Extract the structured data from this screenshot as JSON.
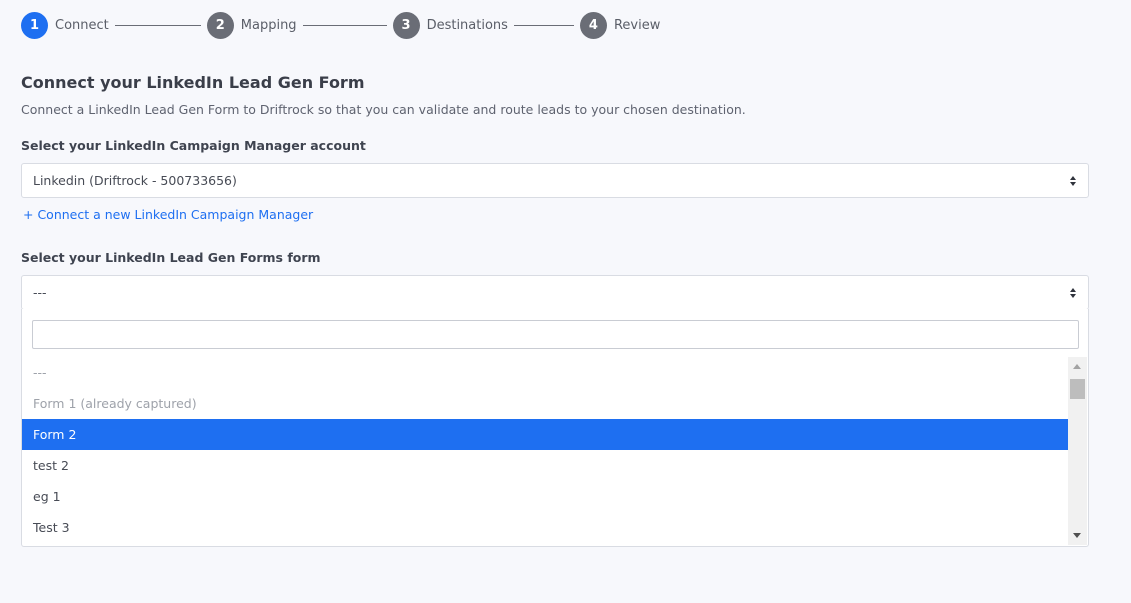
{
  "stepper": {
    "steps": [
      {
        "number": "1",
        "label": "Connect"
      },
      {
        "number": "2",
        "label": "Mapping"
      },
      {
        "number": "3",
        "label": "Destinations"
      },
      {
        "number": "4",
        "label": "Review"
      }
    ],
    "active_step": 1
  },
  "header": {
    "title": "Connect your LinkedIn Lead Gen Form",
    "description": "Connect a LinkedIn Lead Gen Form to Driftrock so that you can validate and route leads to your chosen destination."
  },
  "account_field": {
    "label": "Select your LinkedIn Campaign Manager account",
    "value": "Linkedin (Driftrock - 500733656)"
  },
  "connect_link": "+ Connect a new LinkedIn Campaign Manager",
  "form_field": {
    "label": "Select your LinkedIn Lead Gen Forms form",
    "value": "---",
    "search_value": "",
    "options": [
      {
        "label": "---",
        "state": "muted"
      },
      {
        "label": "Form 1 (already captured)",
        "state": "muted"
      },
      {
        "label": "Form 2",
        "state": "selected"
      },
      {
        "label": "test 2",
        "state": "normal"
      },
      {
        "label": "eg 1",
        "state": "normal"
      },
      {
        "label": "Test 3",
        "state": "normal"
      }
    ]
  },
  "colors": {
    "accent": "#1e6ff1",
    "step_inactive": "#6a6d76",
    "background": "#f7f8fc"
  }
}
